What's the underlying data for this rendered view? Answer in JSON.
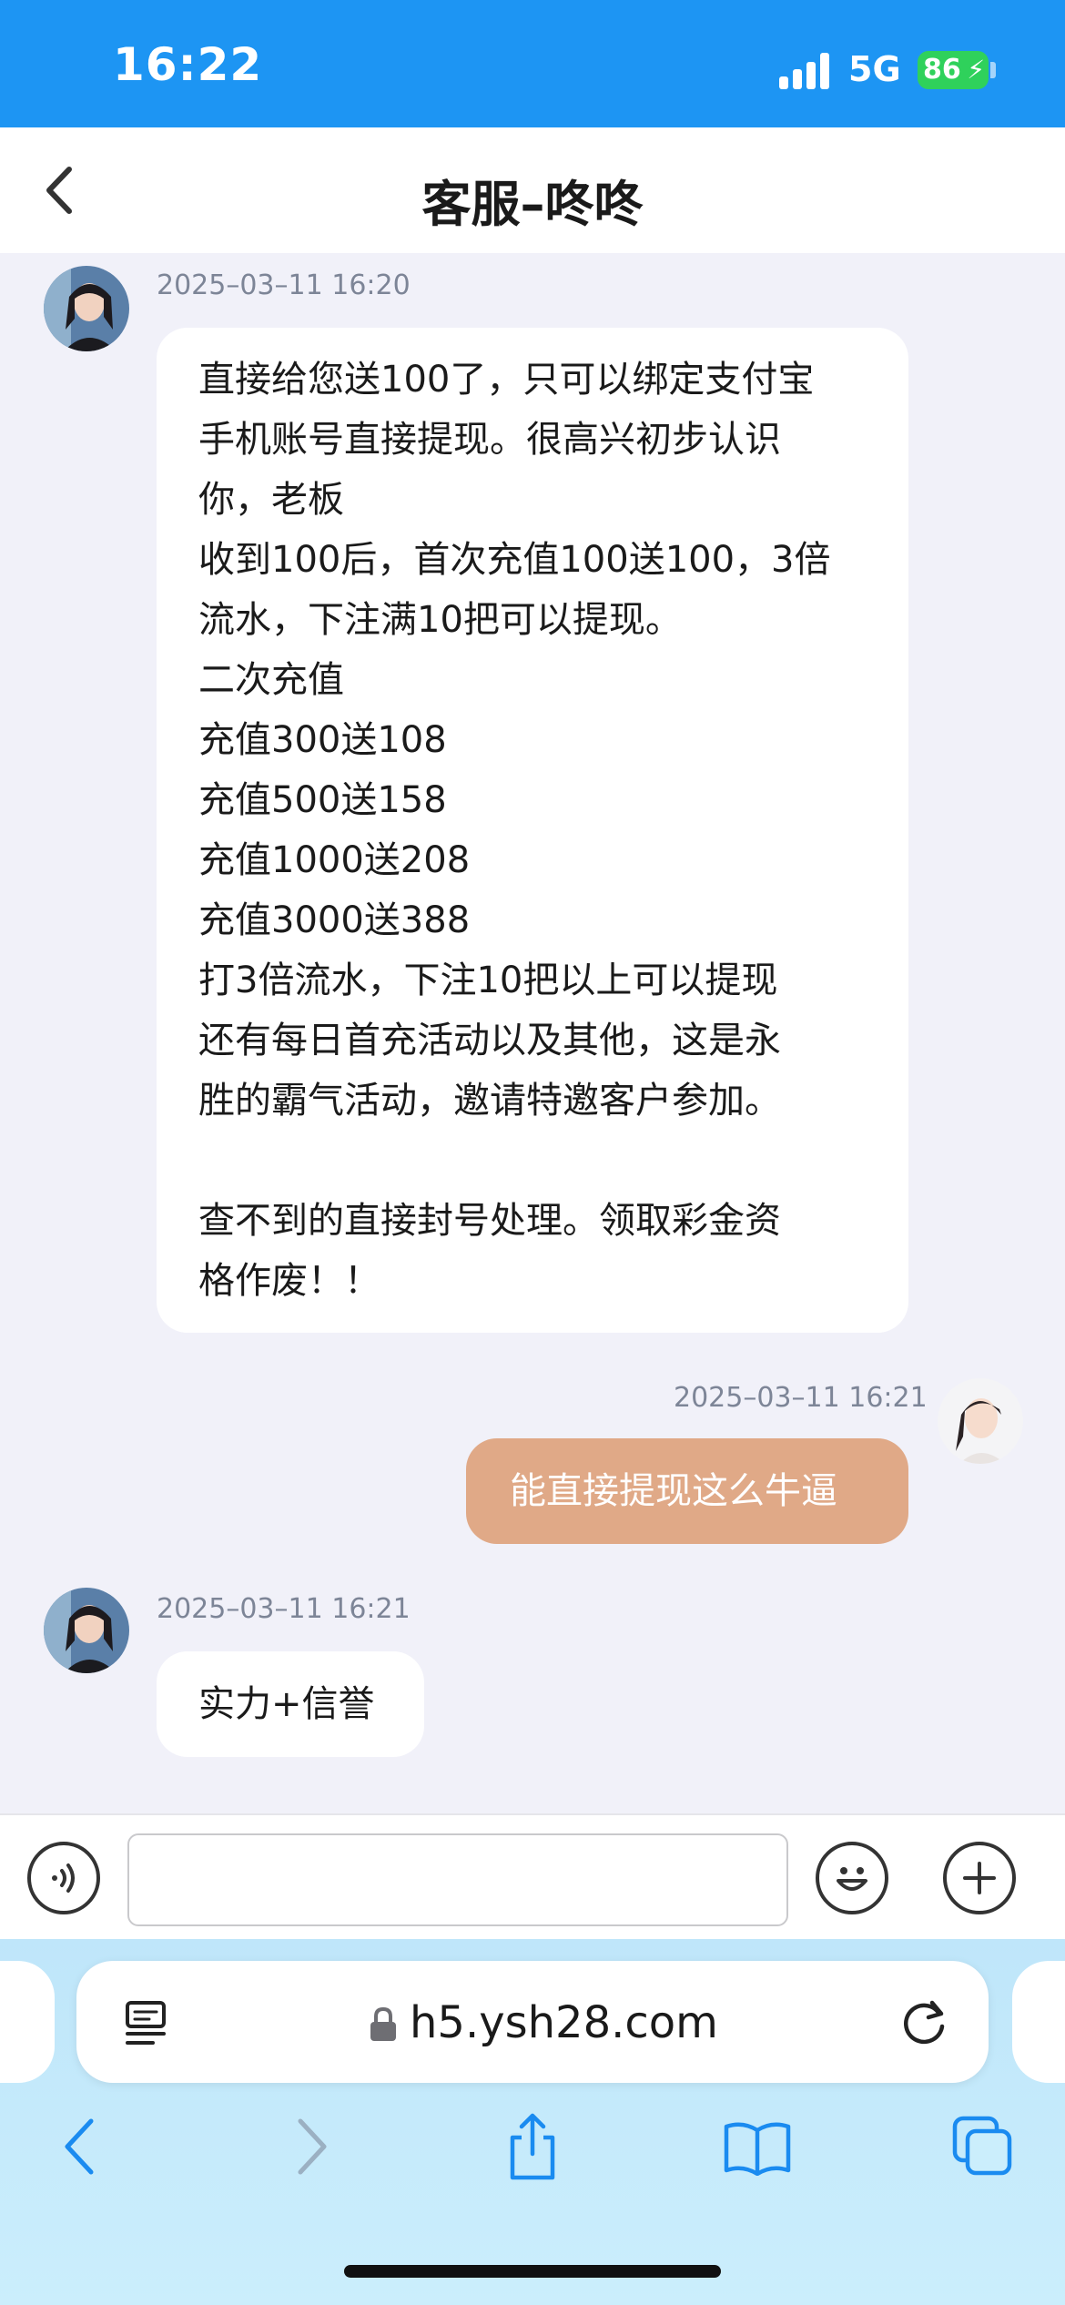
{
  "status_bar": {
    "time": "16:22",
    "network": "5G",
    "battery": "86"
  },
  "header": {
    "title": "客服–咚咚",
    "back_icon": "chevron-left-icon"
  },
  "messages": [
    {
      "direction": "incoming",
      "timestamp": "2025–03–11 16:20",
      "lines": [
        "直接给您送100了，只可以绑定支付宝",
        "手机账号直接提现。很高兴初步认识",
        "你，老板",
        "收到100后，首次充值100送100，3倍",
        "流水，下注满10把可以提现。",
        "二次充值",
        "充值300送108",
        "充值500送158",
        "充值1000送208",
        "充值3000送388",
        "打3倍流水，下注10把以上可以提现",
        "还有每日首充活动以及其他，这是永",
        "胜的霸气活动，邀请特邀客户参加。",
        "",
        "查不到的直接封号处理。领取彩金资",
        "格作废！！"
      ]
    },
    {
      "direction": "outgoing",
      "timestamp": "2025–03–11 16:21",
      "lines": [
        "能直接提现这么牛逼"
      ]
    },
    {
      "direction": "incoming",
      "timestamp": "2025–03–11 16:21",
      "lines": [
        "实力+信誉"
      ]
    }
  ],
  "input_bar": {
    "voice_icon": "voice-icon",
    "input_value": "",
    "input_placeholder": "",
    "emoji_icon": "emoji-icon",
    "add_icon": "plus-icon"
  },
  "browser": {
    "url": "h5.ysh28.com",
    "reader_icon": "reader-icon",
    "lock_icon": "lock-icon",
    "reload_icon": "reload-icon",
    "toolbar": [
      "back-icon",
      "forward-icon",
      "share-icon",
      "bookmarks-icon",
      "tabs-icon"
    ]
  },
  "colors": {
    "status_bar": "#1d95f3",
    "outgoing_bubble": "#e0a987",
    "chat_background": "#f1f1f9",
    "battery": "#2fd15b"
  }
}
